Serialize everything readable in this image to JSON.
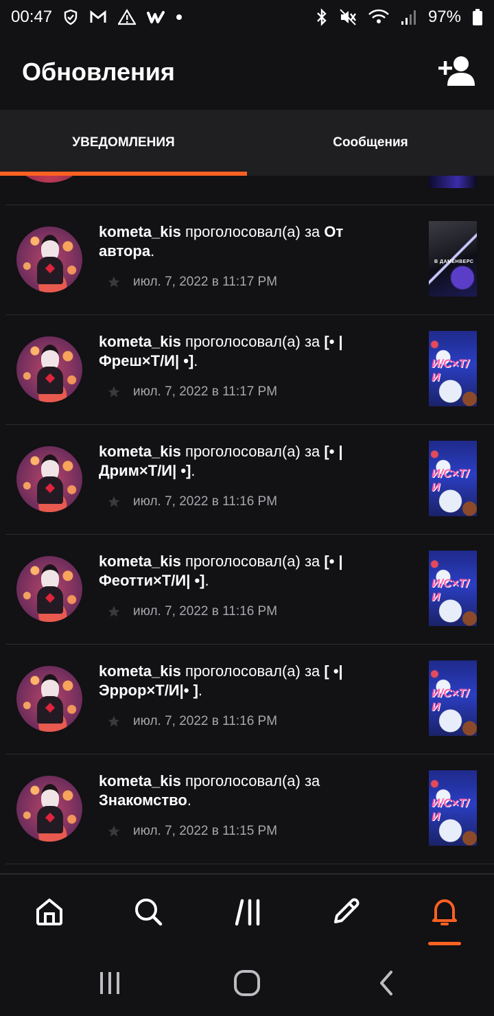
{
  "status_bar": {
    "time": "00:47",
    "battery": "97%",
    "left_icons": [
      "shield-icon",
      "gmail-icon",
      "warning-icon",
      "wattpad-icon",
      "dot-icon"
    ],
    "right_icons": [
      "bluetooth-icon",
      "mute-icon",
      "wifi-icon",
      "signal-icon",
      "battery-icon"
    ]
  },
  "header": {
    "title": "Обновления",
    "action_icon": "add-user-icon"
  },
  "tabs": [
    {
      "label": "УВЕДОМЛЕНИЯ",
      "active": true
    },
    {
      "label": "Сообщения",
      "active": false
    }
  ],
  "accent_color": "#ff6122",
  "notifications": [
    {
      "user": "kometa_kis",
      "action": " проголосовал(а) за ",
      "story": "От автора",
      "end": ".",
      "time": "июл. 7, 2022 в 11:17 PM",
      "thumb": "dark",
      "thumb_caption": "В ДАМЕНВЕРС"
    },
    {
      "user": "kometa_kis",
      "action": " проголосовал(а) за ",
      "story": "[• | Фреш×Т/И| •]",
      "end": ".",
      "time": "июл. 7, 2022 в 11:17 PM",
      "thumb": "sans",
      "thumb_caption": "И/С×Т/И"
    },
    {
      "user": "kometa_kis",
      "action": " проголосовал(а) за ",
      "story": "[• | Дрим×Т/И| •]",
      "end": ".",
      "time": "июл. 7, 2022 в 11:16 PM",
      "thumb": "sans",
      "thumb_caption": "И/С×Т/И"
    },
    {
      "user": "kometa_kis",
      "action": " проголосовал(а) за ",
      "story": "[• | Феотти×Т/И| •]",
      "end": ".",
      "time": "июл. 7, 2022 в 11:16 PM",
      "thumb": "sans",
      "thumb_caption": "И/С×Т/И"
    },
    {
      "user": "kometa_kis",
      "action": " проголосовал(а) за ",
      "story": "[ •| Эррор×Т/И|• ]",
      "end": ".",
      "time": "июл. 7, 2022 в 11:16 PM",
      "thumb": "sans",
      "thumb_caption": "И/С×Т/И"
    },
    {
      "user": "kometa_kis",
      "action": " проголосовал(а) за ",
      "story": "Знакомство",
      "end": ".",
      "time": "июл. 7, 2022 в 11:15 PM",
      "thumb": "sans",
      "thumb_caption": "И/С×Т/И"
    }
  ],
  "bottom_nav": [
    {
      "icon": "home-icon",
      "active": false
    },
    {
      "icon": "search-icon",
      "active": false
    },
    {
      "icon": "library-icon",
      "active": false
    },
    {
      "icon": "pencil-icon",
      "active": false
    },
    {
      "icon": "bell-icon",
      "active": true
    }
  ],
  "system_nav": [
    "recents-icon",
    "home-circle-icon",
    "back-icon"
  ]
}
